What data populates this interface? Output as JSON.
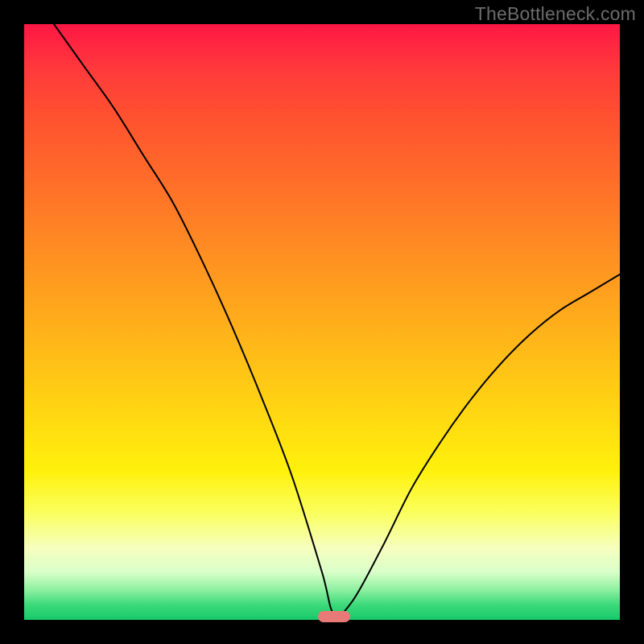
{
  "watermark": "TheBottleneck.com",
  "chart_data": {
    "type": "line",
    "title": "",
    "xlabel": "",
    "ylabel": "",
    "xlim": [
      0,
      100
    ],
    "ylim": [
      0,
      100
    ],
    "grid": false,
    "series": [
      {
        "name": "bottleneck-curve",
        "x": [
          5,
          10,
          15,
          20,
          25,
          30,
          35,
          40,
          45,
          50,
          52,
          55,
          60,
          65,
          70,
          75,
          80,
          85,
          90,
          95,
          100
        ],
        "values": [
          100,
          93,
          86,
          78,
          70,
          60,
          49,
          37,
          24,
          8,
          1,
          3,
          12,
          22,
          30,
          37,
          43,
          48,
          52,
          55,
          58
        ]
      }
    ],
    "annotations": [
      {
        "name": "optimal-marker",
        "x": 52,
        "y": 0.5,
        "color": "#e77a77"
      }
    ],
    "background_gradient": {
      "direction": "vertical",
      "stops": [
        {
          "pos": 0,
          "color": "#ff1744"
        },
        {
          "pos": 50,
          "color": "#ffd000"
        },
        {
          "pos": 80,
          "color": "#faff60"
        },
        {
          "pos": 100,
          "color": "#18c96a"
        }
      ]
    }
  }
}
